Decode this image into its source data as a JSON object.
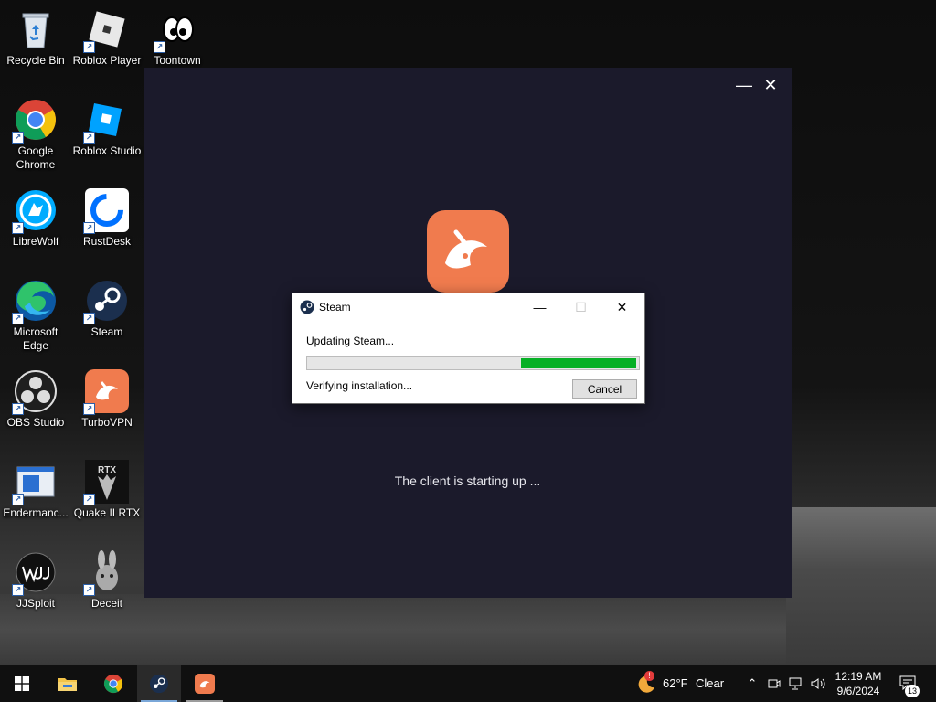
{
  "desktop": {
    "icons": [
      {
        "label": "Recycle Bin",
        "icon": "recycle-bin-icon"
      },
      {
        "label": "Roblox Player",
        "icon": "roblox-player-icon"
      },
      {
        "label": "Toontown",
        "icon": "toontown-icon"
      },
      {
        "label": "Google Chrome",
        "icon": "chrome-icon"
      },
      {
        "label": "Roblox Studio",
        "icon": "roblox-studio-icon"
      },
      {
        "label": "LibreWolf",
        "icon": "librewolf-icon"
      },
      {
        "label": "RustDesk",
        "icon": "rustdesk-icon"
      },
      {
        "label": "Microsoft Edge",
        "icon": "edge-icon"
      },
      {
        "label": "Steam",
        "icon": "steam-icon"
      },
      {
        "label": "OBS Studio",
        "icon": "obs-icon"
      },
      {
        "label": "TurboVPN",
        "icon": "turbovpn-icon"
      },
      {
        "label": "Endermanc...",
        "icon": "endermanch-icon"
      },
      {
        "label": "Quake II RTX",
        "icon": "quake-rtx-icon"
      },
      {
        "label": "JJSploit",
        "icon": "jjsploit-icon"
      },
      {
        "label": "Deceit",
        "icon": "deceit-icon"
      }
    ]
  },
  "launcher": {
    "status": "The client is starting up ...",
    "minimize": "—",
    "close": "✕",
    "accent": "#f07b4e"
  },
  "steam_dialog": {
    "title": "Steam",
    "updating": "Updating Steam...",
    "verifying": "Verifying installation...",
    "cancel": "Cancel",
    "progress_fraction": 0.35,
    "progress_color": "#06b025",
    "minimize": "—",
    "maximize": "☐",
    "close": "✕"
  },
  "taskbar": {
    "apps": [
      "start-icon",
      "file-explorer-icon",
      "chrome-icon",
      "steam-icon",
      "turbovpn-icon"
    ],
    "weather": {
      "temp": "62°F",
      "condition": "Clear",
      "badge": "!"
    },
    "time": "12:19 AM",
    "date": "9/6/2024",
    "notifications": "13"
  }
}
